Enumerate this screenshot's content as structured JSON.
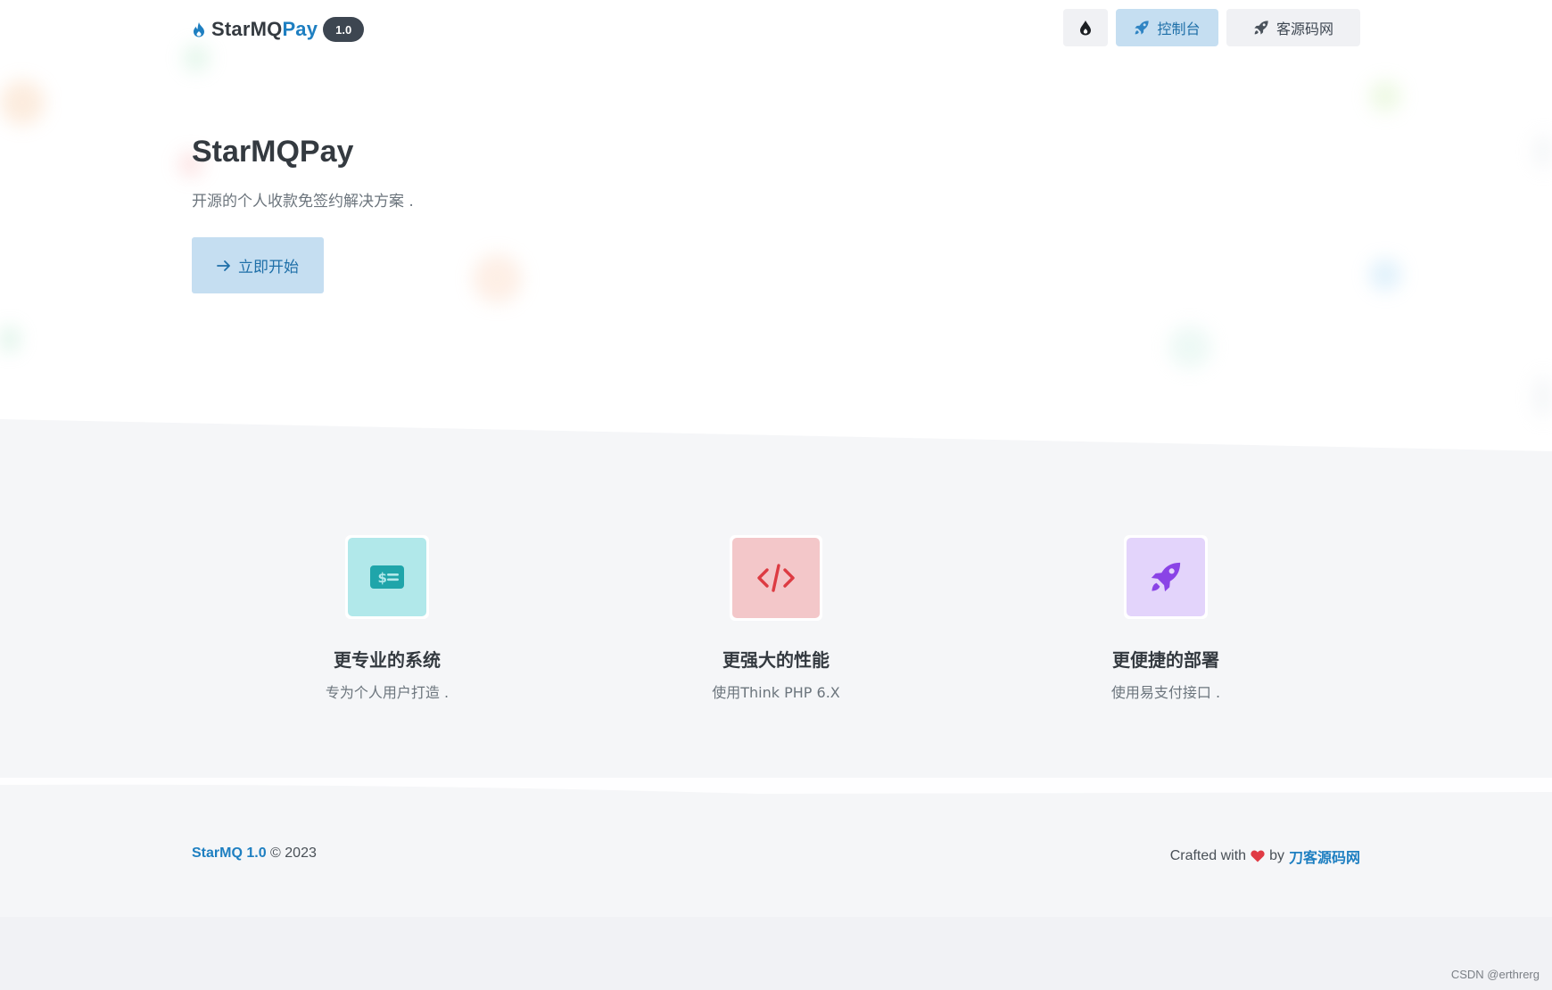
{
  "header": {
    "logo": {
      "text_main": "StarMQ",
      "text_accent": "Pay",
      "version": "1.0"
    },
    "actions": {
      "theme_icon": "droplet-icon",
      "console_label": "控制台",
      "console_icon": "rocket-icon",
      "site_label": "客源码网",
      "site_icon": "rocket-icon"
    }
  },
  "hero": {
    "title": "StarMQPay",
    "subtitle": "开源的个人收款免签约解决方案 .",
    "start_button_label": "立即开始",
    "start_button_icon": "arrow-right-icon"
  },
  "features": [
    {
      "icon": "money-bill-icon",
      "title": "更专业的系统",
      "desc": "专为个人用户打造 .",
      "color": "#b1e8ea",
      "fg": "#19a3a8"
    },
    {
      "icon": "code-icon",
      "title": "更强大的性能",
      "desc": "使用Think PHP 6.X",
      "color": "#f3c7c9",
      "fg": "#dd3b42"
    },
    {
      "icon": "rocket-icon",
      "title": "更便捷的部署",
      "desc": "使用易支付接口 .",
      "color": "#e3d4fb",
      "fg": "#8a43e6"
    }
  ],
  "footer": {
    "brand": "StarMQ 1.0",
    "copyright": "© 2023",
    "crafted_prefix": "Crafted with",
    "crafted_by": "by",
    "author_link": "刀客源码网"
  },
  "watermark": "CSDN @erthrerg",
  "colors": {
    "accent": "#1e7fc1",
    "accent_soft": "#c5def1",
    "text_dark": "#343a40",
    "text_muted": "#6c757d"
  }
}
